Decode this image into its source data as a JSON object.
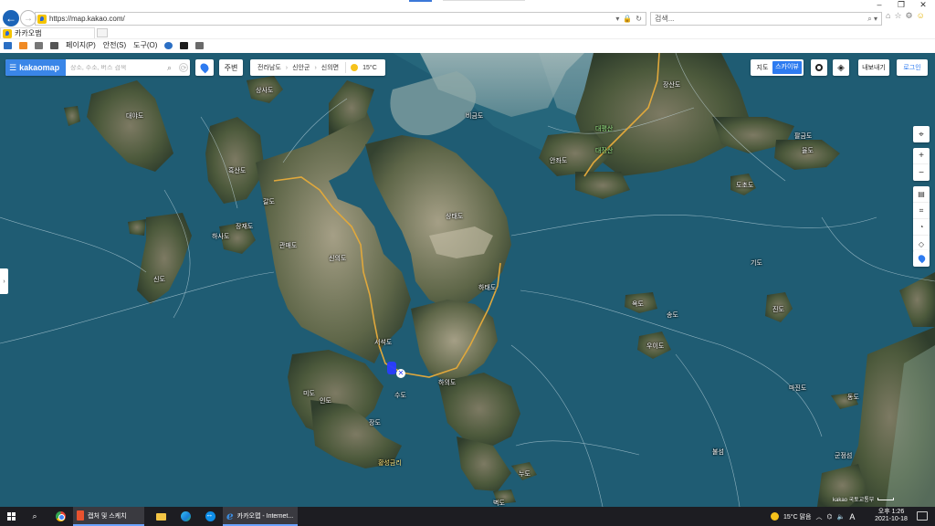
{
  "browser": {
    "url": "https://map.kakao.com/",
    "search_placeholder": "검색...",
    "tab_title": "카카오맵",
    "commands": {
      "page": "페이지(P)",
      "safety": "안전(S)",
      "tools": "도구(O)"
    }
  },
  "kakaomap": {
    "brand": "kakaomap",
    "search_placeholder": "장소, 주소, 버스 검색",
    "nearby_label": "주변",
    "breadcrumb": [
      "전라남도",
      "신안군",
      "신의면"
    ],
    "weather_temp": "15°C",
    "maptype": {
      "map": "지도",
      "skyview": "스카이뷰"
    },
    "export_label": "내보내기",
    "login_label": "로그인",
    "footer": "kakao 국토교통부"
  },
  "map_labels": [
    {
      "text": "대야도",
      "type": "normal"
    },
    {
      "text": "흑산도",
      "type": "normal"
    },
    {
      "text": "장재도",
      "type": "normal"
    },
    {
      "text": "신도",
      "type": "normal"
    },
    {
      "text": "관매도",
      "type": "normal"
    },
    {
      "text": "상태도",
      "type": "normal"
    },
    {
      "text": "하의도",
      "type": "normal"
    },
    {
      "text": "장산도",
      "type": "normal"
    },
    {
      "text": "안좌도",
      "type": "normal"
    },
    {
      "text": "팔금도",
      "type": "normal"
    },
    {
      "text": "대장산",
      "type": "mnt"
    },
    {
      "text": "비금도",
      "type": "normal"
    },
    {
      "text": "도초도",
      "type": "normal"
    },
    {
      "text": "하태도",
      "type": "normal"
    },
    {
      "text": "서석도",
      "type": "normal"
    },
    {
      "text": "미도",
      "type": "normal"
    },
    {
      "text": "인도",
      "type": "normal"
    },
    {
      "text": "신의도",
      "type": "normal"
    },
    {
      "text": "황성금리",
      "type": "hl"
    },
    {
      "text": "율도",
      "type": "normal"
    },
    {
      "text": "송도",
      "type": "normal"
    },
    {
      "text": "기도",
      "type": "normal"
    },
    {
      "text": "누도",
      "type": "normal"
    },
    {
      "text": "벽도",
      "type": "normal"
    },
    {
      "text": "우이도",
      "type": "normal"
    },
    {
      "text": "진도",
      "type": "normal"
    },
    {
      "text": "동도",
      "type": "normal"
    },
    {
      "text": "불섬",
      "type": "normal"
    },
    {
      "text": "상사도",
      "type": "normal"
    },
    {
      "text": "하사도",
      "type": "normal"
    },
    {
      "text": "옥도",
      "type": "normal"
    },
    {
      "text": "마진도",
      "type": "normal"
    },
    {
      "text": "대평산",
      "type": "mnt"
    },
    {
      "text": "군점섬",
      "type": "normal"
    },
    {
      "text": "갈도",
      "type": "normal"
    },
    {
      "text": "수도",
      "type": "normal"
    },
    {
      "text": "장도",
      "type": "normal"
    }
  ],
  "taskbar": {
    "capture_label": "캡처 및 스케치",
    "ie_label": "카카오맵 - Internet...",
    "tray_weather": "15°C 맑음",
    "ime": "A",
    "clock_time": "오후 1:26",
    "clock_date": "2021-10-18"
  }
}
